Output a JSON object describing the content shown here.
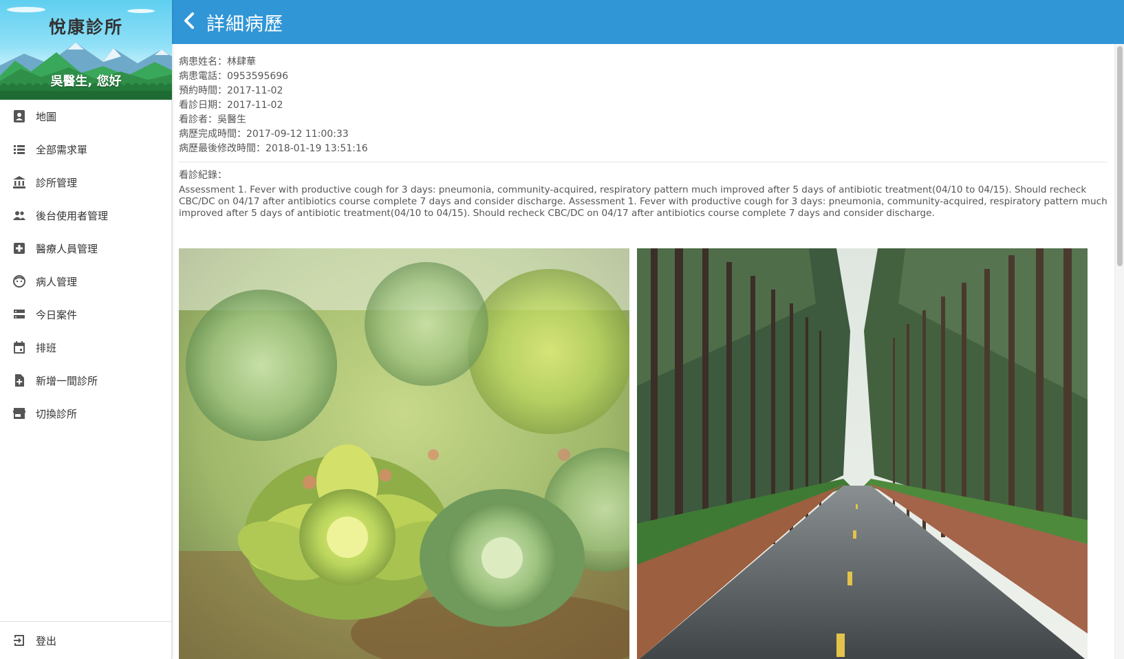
{
  "sidebar": {
    "clinic_name": "悅康診所",
    "greeting": "吳醫生, 您好",
    "items": [
      {
        "label": "地圖",
        "icon": "contact-card-icon"
      },
      {
        "label": "全部需求單",
        "icon": "list-icon"
      },
      {
        "label": "診所管理",
        "icon": "bank-icon"
      },
      {
        "label": "後台使用者管理",
        "icon": "people-icon"
      },
      {
        "label": "醫療人員管理",
        "icon": "medical-cross-icon"
      },
      {
        "label": "病人管理",
        "icon": "face-icon"
      },
      {
        "label": "今日案件",
        "icon": "storage-icon"
      },
      {
        "label": "排班",
        "icon": "calendar-icon"
      },
      {
        "label": "新增一間診所",
        "icon": "note-add-icon"
      },
      {
        "label": "切換診所",
        "icon": "store-icon"
      }
    ],
    "logout_label": "登出"
  },
  "header": {
    "title": "詳細病歷"
  },
  "details": {
    "patient_name": "病患姓名：林肆華",
    "patient_phone": "病患電話：0953595696",
    "appointment_time": "預約時間：2017-11-02",
    "visit_date": "看診日期：2017-11-02",
    "doctor": "看診者：吳醫生",
    "completed_time": "病歷完成時間：2017-09-12 11:00:33",
    "last_modified": "病歷最後修改時間：2018-01-19 13:51:16"
  },
  "record": {
    "label": "看診紀錄：",
    "text": "Assessment 1. Fever with productive cough for 3 days: pneumonia, community-acquired, respiratory pattern much improved after 5 days of antibiotic treatment(04/10 to 04/15). Should recheck CBC/DC on 04/17 after antibiotics course complete 7 days and consider discharge. Assessment 1. Fever with productive cough for 3 days: pneumonia, community-acquired, respiratory pattern much improved after 5 days of antibiotic treatment(04/10 to 04/15). Should recheck CBC/DC on 04/17 after antibiotics course complete 7 days and consider discharge."
  },
  "colors": {
    "header": "#3196d6",
    "icon": "#555555",
    "text": "#333333"
  }
}
